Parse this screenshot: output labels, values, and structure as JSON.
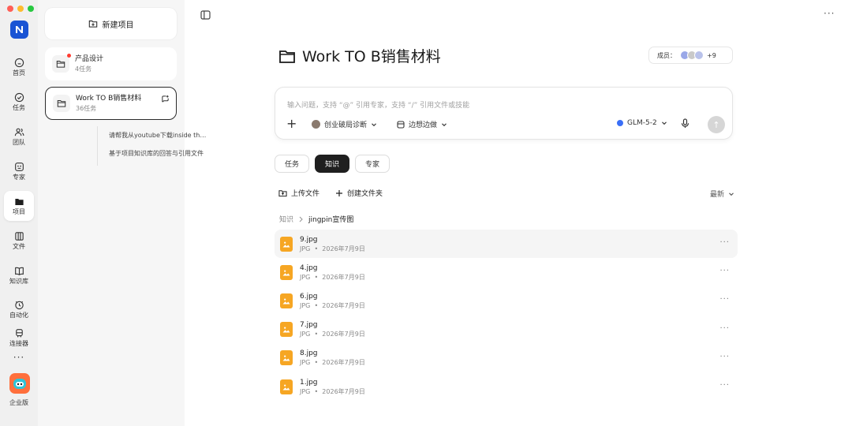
{
  "window": {
    "traffic_lights": [
      "#ff5f57",
      "#febc2e",
      "#28c840"
    ]
  },
  "rail": {
    "logo_icon": "app-logo",
    "items": [
      {
        "label": "首页",
        "icon": "home-icon"
      },
      {
        "label": "任务",
        "icon": "check-circle-icon"
      },
      {
        "label": "团队",
        "icon": "team-icon"
      },
      {
        "label": "专家",
        "icon": "expert-icon"
      },
      {
        "label": "项目",
        "icon": "folder-icon",
        "active": true
      },
      {
        "label": "文件",
        "icon": "files-icon"
      },
      {
        "label": "知识库",
        "icon": "book-icon"
      },
      {
        "label": "自动化",
        "icon": "automation-icon"
      },
      {
        "label": "连接器",
        "icon": "connector-icon"
      }
    ],
    "more": "···",
    "enterprise_label": "企业版"
  },
  "sidebar": {
    "new_project": "新建项目",
    "projects": [
      {
        "title": "产品设计",
        "sub": "4任务",
        "unread": true
      },
      {
        "title": "Work TO B销售材料",
        "sub": "36任务",
        "selected": true
      }
    ],
    "threads": [
      "请帮我从youtube下载inside the ...",
      "基于项目知识库的回答与引用文件"
    ]
  },
  "main": {
    "title": "Work TO B销售材料",
    "members_label": "成员：",
    "members_count": "+9",
    "member_avatar_colors": [
      "#9aa8e8",
      "#c9c9c9",
      "#b9c2ea"
    ],
    "composer": {
      "placeholder": "输入问题，支持 “@” 引用专家，支持 “/” 引用文件或技能",
      "plus": "+",
      "expert": "创业破局诊断",
      "mode": "边想边做",
      "model": "GLM-5-2",
      "send": "↑"
    },
    "tabs": [
      {
        "label": "任务"
      },
      {
        "label": "知识",
        "active": true
      },
      {
        "label": "专家"
      }
    ],
    "toolbar": {
      "upload": "上传文件",
      "create_folder": "创建文件夹",
      "sort": "最新"
    },
    "breadcrumb": {
      "root": "知识",
      "current": "jingpin宣传图"
    },
    "files": [
      {
        "name": "9.jpg",
        "type": "JPG",
        "date": "2026年7月9日"
      },
      {
        "name": "4.jpg",
        "type": "JPG",
        "date": "2026年7月9日"
      },
      {
        "name": "6.jpg",
        "type": "JPG",
        "date": "2026年7月9日"
      },
      {
        "name": "7.jpg",
        "type": "JPG",
        "date": "2026年7月9日"
      },
      {
        "name": "8.jpg",
        "type": "JPG",
        "date": "2026年7月9日"
      },
      {
        "name": "1.jpg",
        "type": "JPG",
        "date": "2026年7月9日"
      }
    ],
    "bullet": "•",
    "more": "···"
  }
}
